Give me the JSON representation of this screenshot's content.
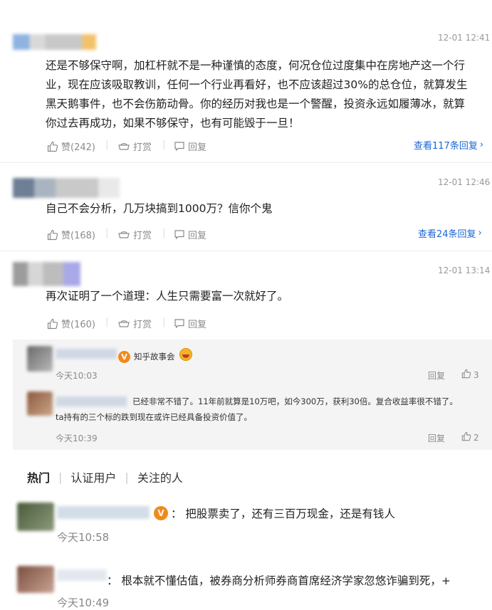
{
  "comments": [
    {
      "time": "12-01 12:41",
      "text_lines": [
        "还是不够保守啊，加杠杆就不是一种谨慎的态度，何况仓位过度集中在房地产这一个行",
        "业，现在应该吸取教训，任何一个行业再看好，也不应该超过30%的总仓位，就算发生",
        "黑天鹅事件，也不会伤筋动骨。你的经历对我也是一个警醒，投资永远如履薄冰，就算",
        "你过去再成功，如果不够保守，也有可能毁于一旦！"
      ],
      "like_label": "赞(242)",
      "tip_label": "打赏",
      "reply_label": "回复",
      "more_replies": "查看117条回复"
    },
    {
      "time": "12-01 12:46",
      "text_lines": [
        "自己不会分析，几万块搞到1000万？信你个鬼"
      ],
      "like_label": "赞(168)",
      "tip_label": "打赏",
      "reply_label": "回复",
      "more_replies": "查看24条回复"
    },
    {
      "time": "12-01 13:14",
      "text_lines": [
        "再次证明了一个道理：人生只需要富一次就好了。"
      ],
      "like_label": "赞(160)",
      "tip_label": "打赏",
      "reply_label": "回复"
    }
  ],
  "sub_replies": [
    {
      "text": "知乎故事会",
      "time": "今天10:03",
      "reply_label": "回复",
      "likes": "3"
    },
    {
      "text_lines": [
        "已经非常不错了。11年前就算是10万吧，如今300万，获利30倍。复合收益率很不错了。",
        "ta持有的三个标的跌到现在或许已经具备投资价值了。"
      ],
      "time": "今天10:39",
      "reply_label": "回复",
      "likes": "2"
    }
  ],
  "tabs": [
    "热门",
    "认证用户",
    "关注的人"
  ],
  "hot_comments": [
    {
      "text": "：  把股票卖了，还有三百万现金，还是有钱人",
      "time": "今天10:58"
    },
    {
      "text": "：  根本就不懂估值，被券商分析师券商首席经济学家忽悠诈骗到死，+",
      "time": "今天10:49"
    }
  ],
  "colors": {
    "link": "#1a66d6",
    "muted": "#8a8a8a",
    "badge": "#f08a1c"
  }
}
